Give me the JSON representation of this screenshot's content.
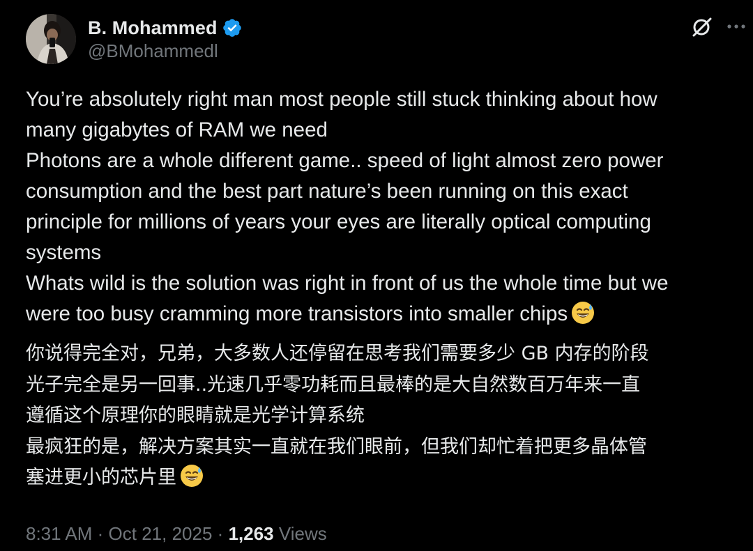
{
  "author": {
    "display_name": "B. Mohammed",
    "handle": "@BMohammedl",
    "verified": true,
    "avatar_icon": "user-avatar-photo"
  },
  "header_icons": {
    "grok": "grok-icon",
    "more": "more-options-icon"
  },
  "body_en": {
    "lines": [
      "You’re absolutely right man most people still stuck thinking about how",
      "many gigabytes of RAM we need",
      "Photons are a whole different game.. speed of light almost zero power",
      "consumption and the best part nature’s been running on this exact",
      "principle for millions of years your eyes are literally optical computing",
      "systems",
      "Whats wild is the solution was right in front of us the whole time but we",
      "were too busy cramming more transistors into smaller chips"
    ],
    "emoji": "grinning-face-with-sweat-icon"
  },
  "body_zh": {
    "lines": [
      "你说得完全对，兄弟，大多数人还停留在思考我们需要多少 GB 内存的阶段",
      "光子完全是另一回事..光速几乎零功耗而且最棒的是大自然数百万年来一直",
      "遵循这个原理你的眼睛就是光学计算系统",
      "最疯狂的是，解决方案其实一直就在我们眼前，但我们却忙着把更多晶体管",
      "塞进更小的芯片里"
    ]
  },
  "meta": {
    "time": "8:31 AM",
    "separator": "·",
    "date": "Oct 21, 2025",
    "views_count": "1,263",
    "views_label": "Views"
  },
  "colors": {
    "background": "#000000",
    "text_primary": "#e7e9ea",
    "text_secondary": "#71767b",
    "verified_badge": "#1d9bf0"
  }
}
